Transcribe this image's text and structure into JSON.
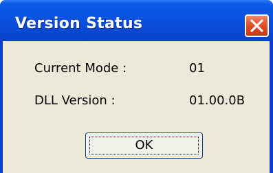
{
  "window": {
    "title": "Version Status",
    "close_icon": "close-x-icon"
  },
  "rows": [
    {
      "label": "Current Mode :",
      "value": "01"
    },
    {
      "label": "DLL Version :",
      "value": "01.00.0B"
    }
  ],
  "buttons": {
    "ok_label": "OK"
  },
  "colors": {
    "titlebar": "#0a53e0",
    "close_button": "#d8431e",
    "dialog_background": "#ece9d8"
  }
}
